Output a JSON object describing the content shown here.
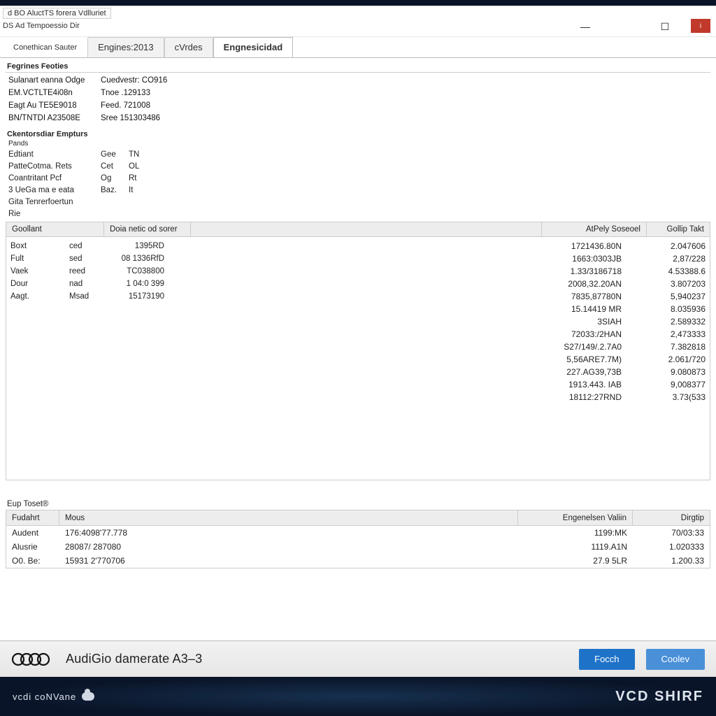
{
  "titlebar": {
    "top": "d BO AluctTS forera Vdlluriet",
    "sub": "DS Ad Tempoessio Dir"
  },
  "tabs": {
    "t0": "Conethican Sauter",
    "t1": "Engines:2013",
    "t2": "cVrdes",
    "t3": "Engnesicidad"
  },
  "group1": {
    "label": "Fegrines Feoties",
    "rows": [
      {
        "k": "Sulanart eanna Odge",
        "v": "Cuedvestr: CO916"
      },
      {
        "k": "EM.VCTLTE4i08n",
        "v": "Tnoe .129133"
      },
      {
        "k": "Eagt Au TE5E9018",
        "v": "Feed. 721008"
      },
      {
        "k": "BN/TNTDI A23508E",
        "v": "Sree 151303486"
      }
    ]
  },
  "group2": {
    "label": "Ckentorsdiar Empturs",
    "sub": "Pands",
    "rows": [
      {
        "k": "Edtiant",
        "c1": "Gee",
        "c2": "TN"
      },
      {
        "k": "PatteCotma. Rets",
        "c1": "Cet",
        "c2": "OL"
      },
      {
        "k": "Coantritant Pcf",
        "c1": "Og",
        "c2": "Rt"
      },
      {
        "k": "3 UeGa ma e eata",
        "c1": "Baz.",
        "c2": "It"
      },
      {
        "k": "Gita Tenrerfoertun",
        "c1": "",
        "c2": ""
      },
      {
        "k": "Rie",
        "c1": "",
        "c2": ""
      }
    ]
  },
  "main_table": {
    "headers": {
      "h1": "Goollant",
      "h2": "Doia netic od sorer",
      "h3": "AtPely Soseoel",
      "h4": "Gollip Takt"
    },
    "left_rows": [
      {
        "a": "Boxt",
        "b": "ced",
        "c": "1395RD"
      },
      {
        "a": "Fult",
        "b": "sed",
        "c": "08 1336RfD"
      },
      {
        "a": "Vaek",
        "b": "reed",
        "c": "TC038800"
      },
      {
        "a": "Dour",
        "b": "nad",
        "c": "1 04:0 399"
      },
      {
        "a": "Aagt.",
        "b": "Msad",
        "c": "15173190"
      }
    ],
    "right_rows": [
      {
        "a": "1721436.80N",
        "b": "2.047606"
      },
      {
        "a": "1663:0303JB",
        "b": "2,87/228"
      },
      {
        "a": "1.33/3186718",
        "b": "4.53388.6"
      },
      {
        "a": "2008,32.20AN",
        "b": "3.807203"
      },
      {
        "a": "7835,87780N",
        "b": "5,940237"
      },
      {
        "a": "15.14419 MR",
        "b": "8.035936"
      },
      {
        "a": "3SIAH",
        "b": "2.589332"
      },
      {
        "a": "72033:/2HAN",
        "b": "2,473333"
      },
      {
        "a": "S27/149/.2.7A0",
        "b": "7.382818"
      },
      {
        "a": "5,56ARE7.7M)",
        "b": "2.061/720"
      },
      {
        "a": "227.AG39,73B",
        "b": "9.080873"
      },
      {
        "a": "1913.443. IAB",
        "b": "9,008377"
      },
      {
        "a": "18112:27RND",
        "b": "3.73(533"
      }
    ]
  },
  "bottom": {
    "label": "Eup Toset®",
    "headers": {
      "h1": "Fudahrt",
      "h2": "Mous",
      "h3": "Engenelsen Valiin",
      "h4": "Dirgtip"
    },
    "rows": [
      {
        "a": "Audent",
        "b": "176:4098'77.778",
        "c": "1199:MK",
        "d": "70/03:33"
      },
      {
        "a": "Alusrie",
        "b": "28087/ 287080",
        "c": "1119.A1N",
        "d": "1.020333"
      },
      {
        "a": "O0. Be:",
        "b": "15931 2'770706",
        "c": "27.9 5LR",
        "d": "1.200.33"
      }
    ]
  },
  "brandbar": {
    "text": "AudiGio damerate A3–3",
    "btn1": "Focch",
    "btn2": "Coolev"
  },
  "footer": {
    "left": "vcdi coNVane",
    "right": "VCD SHIRF"
  }
}
